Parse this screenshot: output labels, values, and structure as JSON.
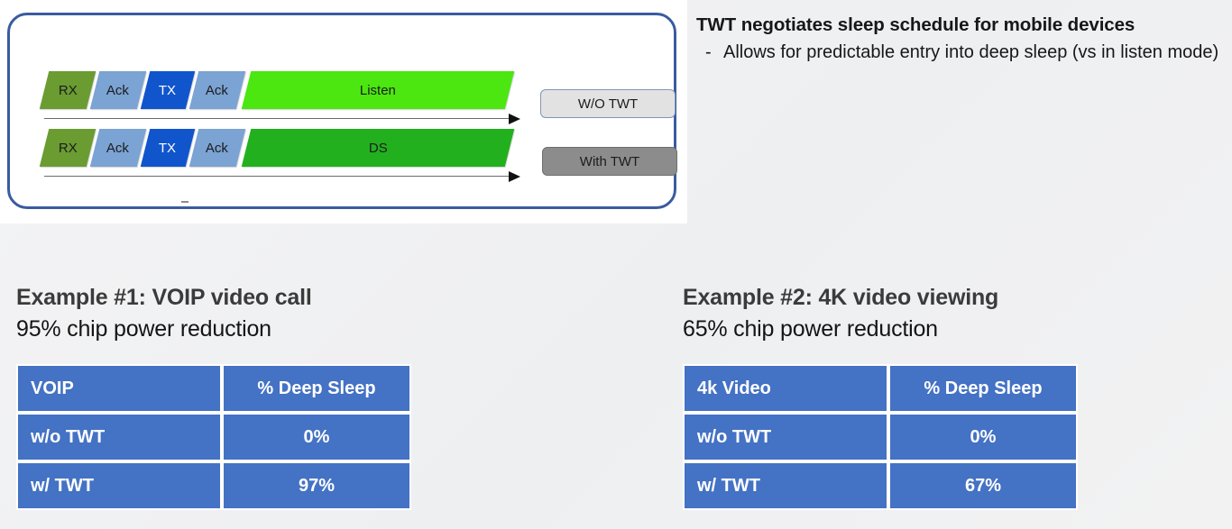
{
  "diagram": {
    "rows": [
      {
        "name": "without-twt",
        "blocks": [
          {
            "label": "RX",
            "kind": "rx"
          },
          {
            "label": "Ack",
            "kind": "ack"
          },
          {
            "label": "TX",
            "kind": "tx"
          },
          {
            "label": "Ack",
            "kind": "ack"
          },
          {
            "label": "Listen",
            "kind": "listen"
          }
        ],
        "legend": "W/O TWT"
      },
      {
        "name": "with-twt",
        "blocks": [
          {
            "label": "RX",
            "kind": "rx"
          },
          {
            "label": "Ack",
            "kind": "ack"
          },
          {
            "label": "TX",
            "kind": "tx"
          },
          {
            "label": "Ack",
            "kind": "ack"
          },
          {
            "label": "DS",
            "kind": "ds"
          }
        ],
        "legend": "With TWT"
      }
    ],
    "colors": {
      "frame_border": "#3a5ba0",
      "rx": "#6a9c32",
      "ack": "#7ba3d3",
      "tx": "#1155cc",
      "listen": "#4ce610",
      "ds": "#23b01e",
      "legend_wo_twt_bg": "#e2e2e2",
      "legend_with_twt_bg": "#8c8c8c"
    }
  },
  "twt": {
    "heading": "TWT negotiates sleep schedule for mobile devices",
    "bullet_marker": "-",
    "bullet": "Allows for predictable entry into deep sleep (vs in listen mode)"
  },
  "examples": [
    {
      "title": "Example #1: VOIP video call",
      "subtitle": "95% chip power reduction",
      "table": {
        "headers": [
          "VOIP",
          "% Deep Sleep"
        ],
        "rows": [
          [
            "w/o TWT",
            "0%"
          ],
          [
            "w/ TWT",
            "97%"
          ]
        ]
      }
    },
    {
      "title": "Example #2: 4K video viewing",
      "subtitle": "65% chip power reduction",
      "table": {
        "headers": [
          "4k Video",
          "% Deep Sleep"
        ],
        "rows": [
          [
            "w/o TWT",
            "0%"
          ],
          [
            "w/ TWT",
            "67%"
          ]
        ]
      }
    }
  ],
  "theme": {
    "table_blue": "#4472c4",
    "page_background": "#f1f1f2"
  }
}
